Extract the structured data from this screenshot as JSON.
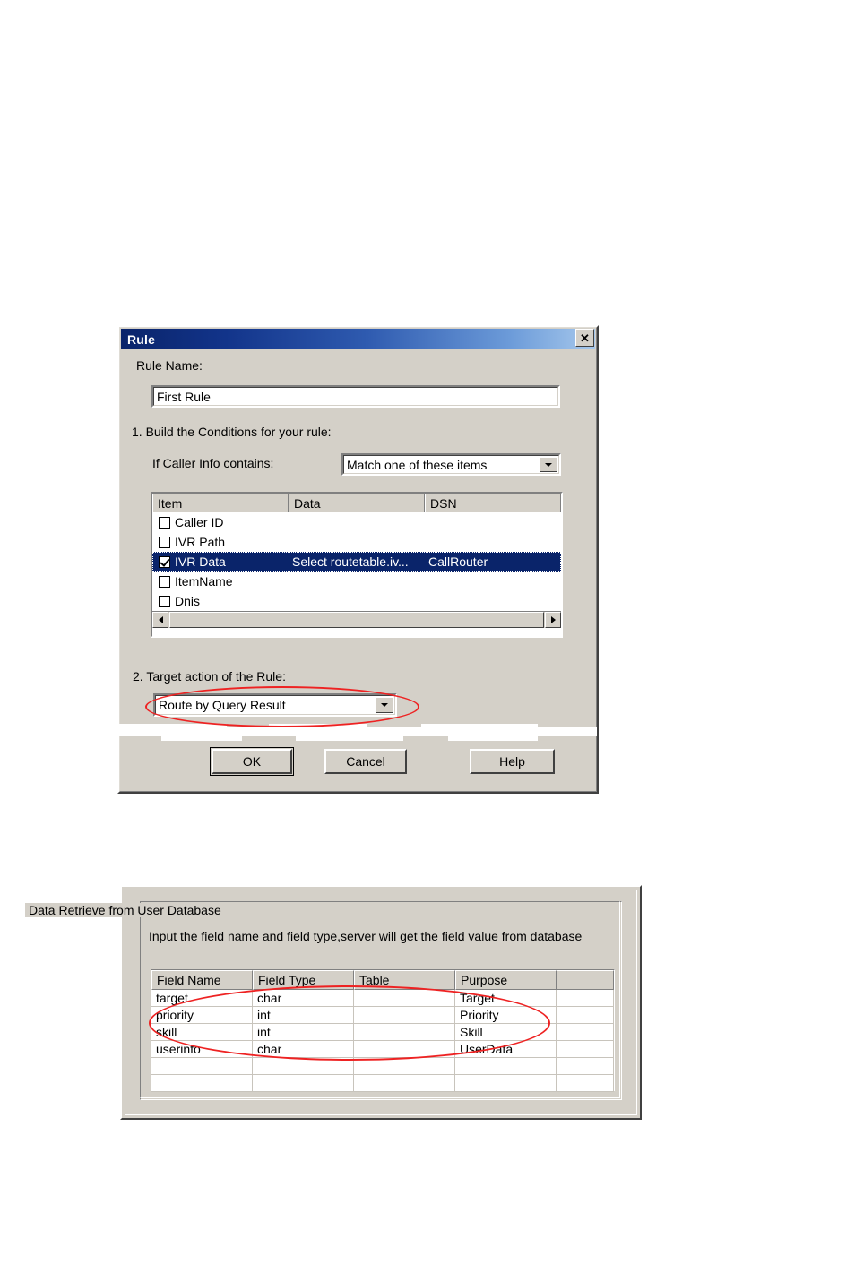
{
  "rule_dialog": {
    "title": "Rule",
    "close_button": "✕",
    "rule_name_label": "Rule Name:",
    "rule_name_value": "First Rule",
    "step1_label": "1. Build the Conditions for your rule:",
    "caller_info_label": "If Caller Info contains:",
    "match_combo_value": "Match one of these items",
    "list": {
      "columns": [
        "Item",
        "Data",
        "DSN"
      ],
      "rows": [
        {
          "checked": false,
          "item": "Caller ID",
          "data": "",
          "dsn": ""
        },
        {
          "checked": false,
          "item": "IVR Path",
          "data": "",
          "dsn": ""
        },
        {
          "checked": true,
          "item": "IVR Data",
          "data": "Select routetable.iv...",
          "dsn": "CallRouter"
        },
        {
          "checked": false,
          "item": "ItemName",
          "data": "",
          "dsn": ""
        },
        {
          "checked": false,
          "item": "Dnis",
          "data": "",
          "dsn": ""
        }
      ],
      "selected_row_index": 2
    },
    "step2_label": "2. Target action of the Rule:",
    "target_action_value": "Route by Query Result",
    "buttons": {
      "ok": "OK",
      "cancel": "Cancel",
      "help": "Help"
    }
  },
  "data_dialog": {
    "group_title": "Data Retrieve from User Database",
    "description": "Input the field name and field type,server will get the field value from database",
    "grid": {
      "columns": [
        "Field Name",
        "Field Type",
        "Table",
        "Purpose",
        ""
      ],
      "rows": [
        {
          "field_name": "target",
          "field_type": "char",
          "table": "",
          "purpose": "Target",
          "extra": ""
        },
        {
          "field_name": "priority",
          "field_type": "int",
          "table": "",
          "purpose": "Priority",
          "extra": ""
        },
        {
          "field_name": "skill",
          "field_type": "int",
          "table": "",
          "purpose": "Skill",
          "extra": ""
        },
        {
          "field_name": "userinfo",
          "field_type": "char",
          "table": "",
          "purpose": "UserData",
          "extra": ""
        },
        {
          "field_name": "",
          "field_type": "",
          "table": "",
          "purpose": "",
          "extra": ""
        },
        {
          "field_name": "",
          "field_type": "",
          "table": "",
          "purpose": "",
          "extra": ""
        }
      ]
    }
  },
  "annotations": {
    "highlight_color": "#ee2222",
    "ovals": [
      "target-action-combo-highlight",
      "grid-rows-highlight"
    ]
  },
  "colors": {
    "dialog_face": "#d4d0c8",
    "titlebar_start": "#0a246a",
    "titlebar_end": "#a6c8ec",
    "selection": "#0a246a",
    "page_background": "#ffffff"
  }
}
